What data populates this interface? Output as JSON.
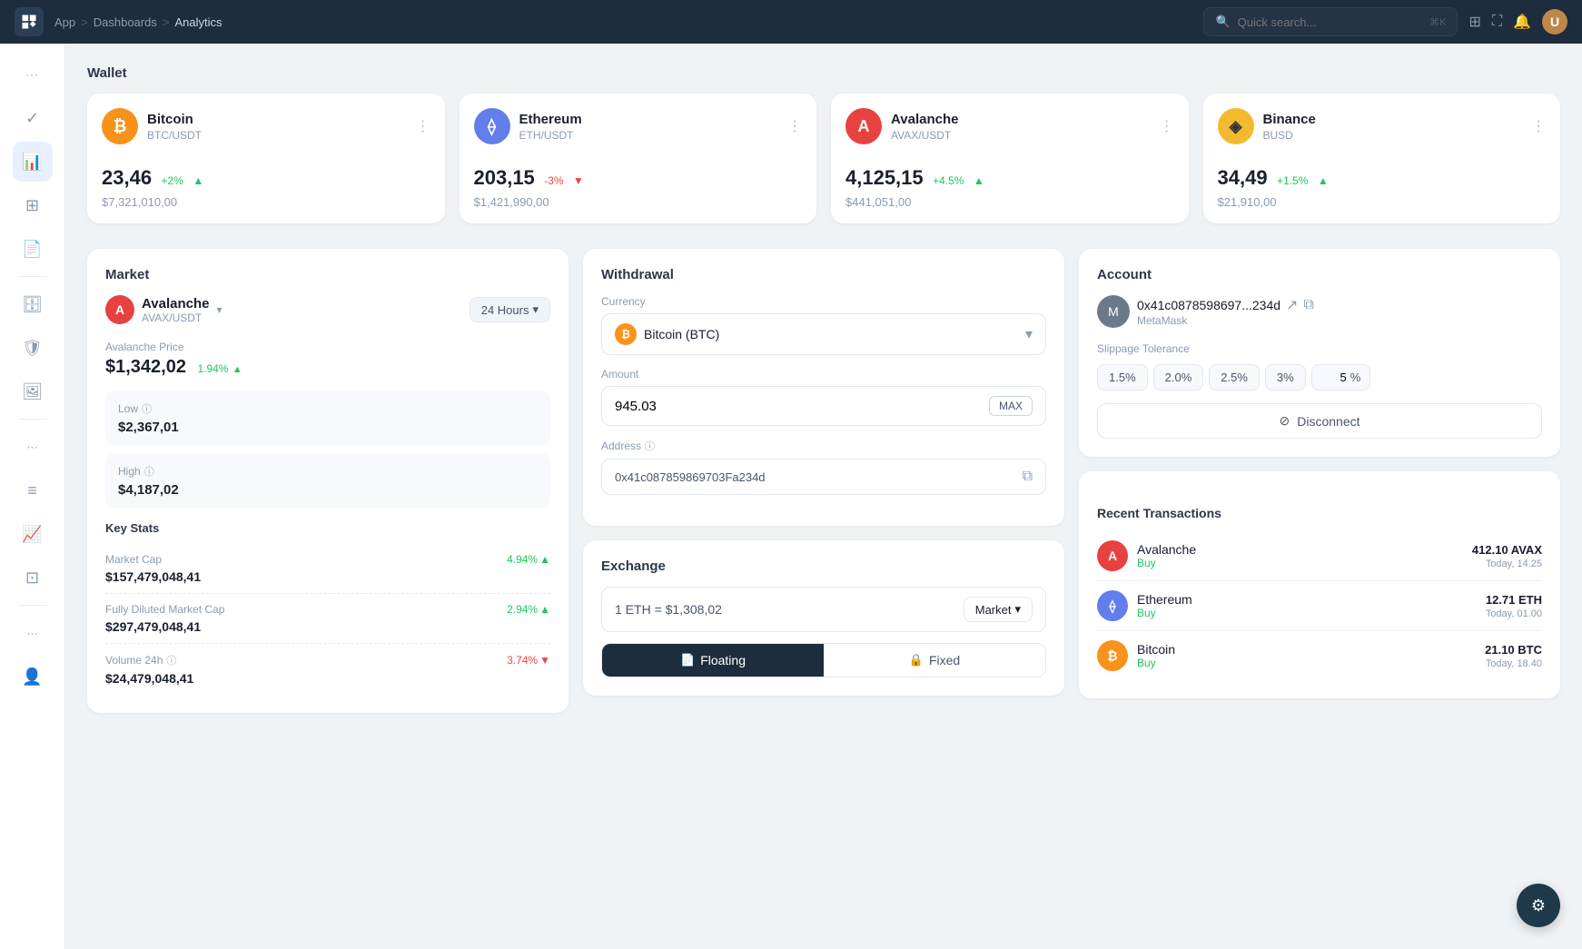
{
  "topbar": {
    "breadcrumb": [
      "App",
      "Dashboards",
      "Analytics"
    ],
    "search_placeholder": "Quick search...",
    "search_shortcut": "⌘K"
  },
  "sidebar": {
    "items": [
      {
        "icon": "dots-icon",
        "label": "...",
        "active": false
      },
      {
        "icon": "check-circle-icon",
        "label": "Tasks",
        "active": false
      },
      {
        "icon": "chart-icon",
        "label": "Analytics",
        "active": true
      },
      {
        "icon": "table-icon",
        "label": "Tables",
        "active": false
      },
      {
        "icon": "document-icon",
        "label": "Documents",
        "active": false
      },
      {
        "icon": "server-icon",
        "label": "Server",
        "active": false
      },
      {
        "icon": "shield-icon",
        "label": "Security",
        "active": false
      },
      {
        "icon": "image-icon",
        "label": "Media",
        "active": false
      },
      {
        "icon": "dots2-icon",
        "label": "More",
        "active": false
      },
      {
        "icon": "text-icon",
        "label": "Text",
        "active": false
      },
      {
        "icon": "chart2-icon",
        "label": "Reports",
        "active": false
      },
      {
        "icon": "grid-icon",
        "label": "Grid",
        "active": false
      },
      {
        "icon": "dots3-icon",
        "label": "More2",
        "active": false
      },
      {
        "icon": "user-icon",
        "label": "Profile",
        "active": false
      }
    ]
  },
  "wallet": {
    "title": "Wallet",
    "cards": [
      {
        "name": "Bitcoin",
        "pair": "BTC/USDT",
        "coin_code": "BTC",
        "value": "23,46",
        "change": "+2%",
        "change_positive": true,
        "usd": "$7,321,010,00"
      },
      {
        "name": "Ethereum",
        "pair": "ETH/USDT",
        "coin_code": "ETH",
        "value": "203,15",
        "change": "-3%",
        "change_positive": false,
        "usd": "$1,421,990,00"
      },
      {
        "name": "Avalanche",
        "pair": "AVAX/USDT",
        "coin_code": "AVAX",
        "value": "4,125,15",
        "change": "+4.5%",
        "change_positive": true,
        "usd": "$441,051,00"
      },
      {
        "name": "Binance",
        "pair": "BUSD",
        "coin_code": "BNB",
        "value": "34,49",
        "change": "+1.5%",
        "change_positive": true,
        "usd": "$21,910,00"
      }
    ]
  },
  "market": {
    "title": "Market",
    "selected_coin": "Avalanche",
    "selected_pair": "AVAX/USDT",
    "time_period": "24 Hours",
    "price_label": "Avalanche Price",
    "price": "$1,342,02",
    "price_change": "1.94%",
    "low_label": "Low",
    "low_val": "$2,367,01",
    "high_label": "High",
    "high_val": "$4,187,02",
    "key_stats_title": "Key Stats",
    "stats": [
      {
        "label": "Market Cap",
        "val": "$157,479,048,41",
        "change": "4.94%",
        "positive": true
      },
      {
        "label": "Fully Diluted Market Cap",
        "val": "$297,479,048,41",
        "change": "2.94%",
        "positive": true
      },
      {
        "label": "Volume 24h",
        "val": "$24,479,048,41",
        "change": "3.74%",
        "positive": false
      }
    ]
  },
  "withdrawal": {
    "title": "Withdrawal",
    "currency_label": "Currency",
    "currency_value": "Bitcoin (BTC)",
    "amount_label": "Amount",
    "amount_value": "945.03",
    "max_label": "MAX",
    "address_label": "Address",
    "address_value": "0x41c087859869703Fa234d",
    "exchange_title": "Exchange",
    "exchange_rate": "1 ETH = $1,308,02",
    "order_type": "Market",
    "floating_label": "Floating",
    "fixed_label": "Fixed"
  },
  "account": {
    "title": "Account",
    "address": "0x41c0878598697...234d",
    "wallet_name": "MetaMask",
    "slippage_title": "Slippage Tolerance",
    "slippage_options": [
      "1.5%",
      "2.0%",
      "2.5%",
      "3%"
    ],
    "slippage_custom_val": "5",
    "slippage_pct": "%",
    "disconnect_label": "Disconnect",
    "recent_tx_title": "Recent Transactions",
    "transactions": [
      {
        "coin": "Avalanche",
        "type": "Buy",
        "amount": "412.10 AVAX",
        "time": "Today, 14.25",
        "coin_code": "AVAX"
      },
      {
        "coin": "Ethereum",
        "type": "Buy",
        "amount": "12.71 ETH",
        "time": "Today, 01.00",
        "coin_code": "ETH"
      },
      {
        "coin": "Bitcoin",
        "type": "Buy",
        "amount": "21.10 BTC",
        "time": "Today, 18.40",
        "coin_code": "BTC"
      }
    ]
  }
}
